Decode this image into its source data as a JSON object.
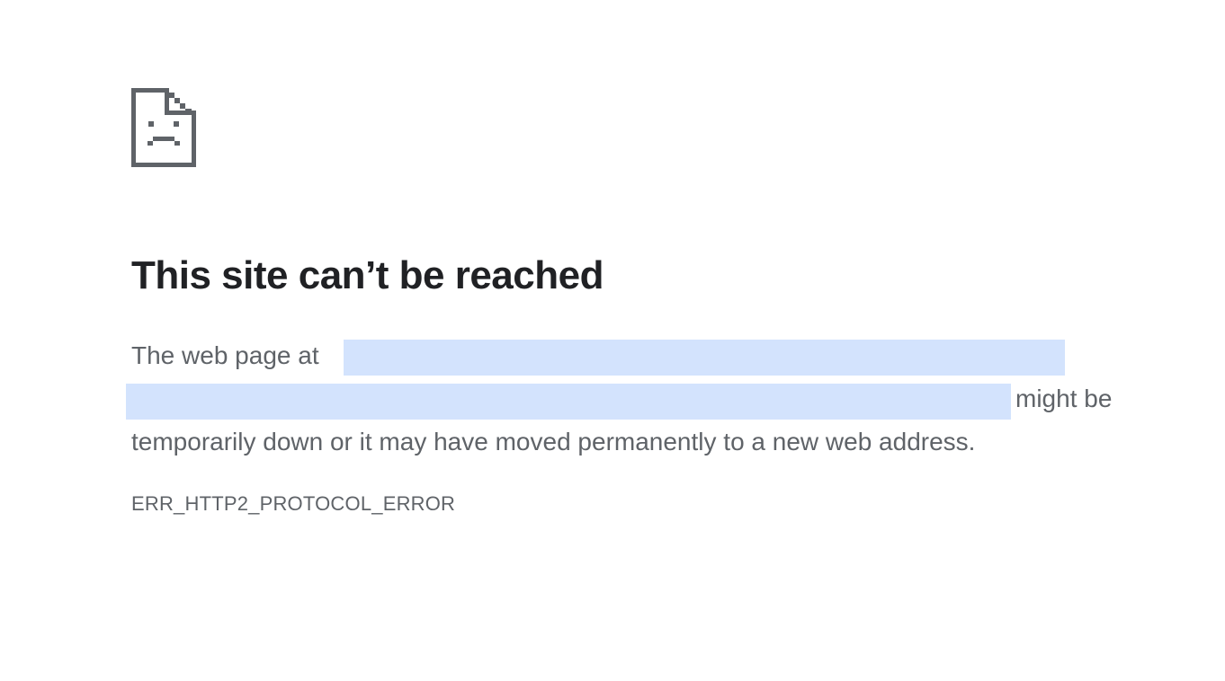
{
  "main": {
    "icon": "sad-page-icon",
    "title": "This site can’t be reached",
    "body": {
      "prefix": "The web page at",
      "suffix_line2": "might be",
      "line3": "temporarily down or it may have moved permanently to a new web address."
    },
    "error_code": "ERR_HTTP2_PROTOCOL_ERROR"
  },
  "colors": {
    "background": "#ffffff",
    "title": "#202124",
    "body_text": "#5f6368",
    "icon": "#5f6368",
    "url_highlight": "#d3e3fd"
  }
}
